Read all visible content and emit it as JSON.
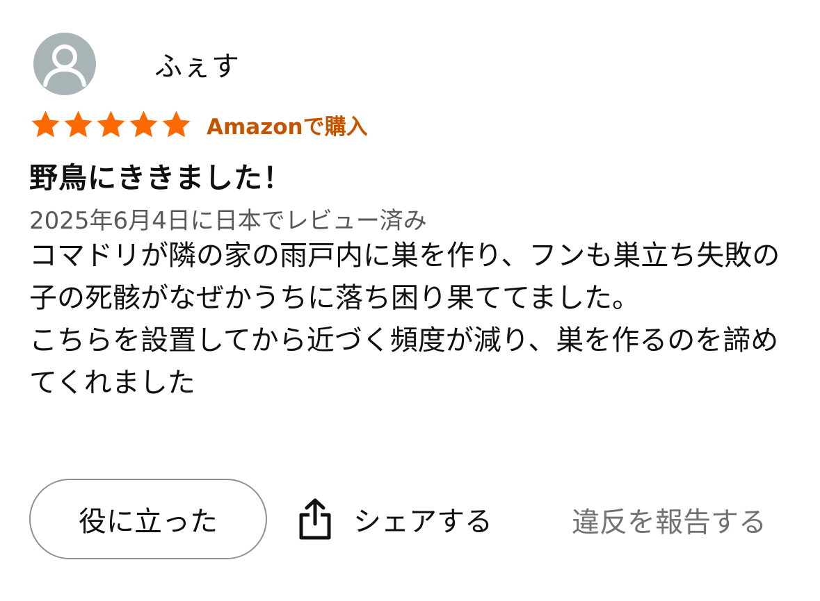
{
  "review": {
    "profile": {
      "name": "ふぇす",
      "avatar_icon": "default-user-icon",
      "avatar_color": "#a9b4b7"
    },
    "rating": {
      "stars": 5,
      "max_stars": 5,
      "star_color": "#ff6a00",
      "star_icon": "star-icon"
    },
    "verified_label": "Amazonで購入",
    "verified_color": "#c45500",
    "title": "野鳥にききました！",
    "date_line": "2025年6月4日に日本でレビュー済み",
    "body": {
      "paragraph_1": "コマドリが隣の家の雨戸内に巣を作り、フンも巣立ち失敗の子の死骸がなぜかうちに落ち困り果ててました。",
      "paragraph_2": "こちらを設置してから近づく頻度が減り、巣を作るのを諦めてくれました"
    },
    "actions": {
      "helpful_label": "役に立った",
      "share_label": "シェアする",
      "share_icon": "share-icon",
      "report_label": "違反を報告する"
    }
  }
}
